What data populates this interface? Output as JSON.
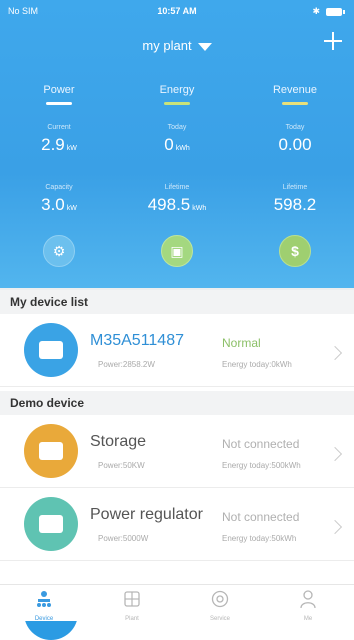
{
  "status_bar": {
    "carrier": "No SIM",
    "time": "10:57 AM"
  },
  "header": {
    "plant_selector": "my plant"
  },
  "tabs": [
    {
      "label": "Power"
    },
    {
      "label": "Energy"
    },
    {
      "label": "Revenue"
    }
  ],
  "stats": {
    "current": {
      "label": "Current",
      "value": "2.9",
      "unit": "kW"
    },
    "today": {
      "label": "Today",
      "value": "0",
      "unit": "kWh"
    },
    "today_revenue": {
      "label": "Today",
      "value": "0.00"
    },
    "capacity": {
      "label": "Capacity",
      "value": "3.0",
      "unit": "kW"
    },
    "lifetime_energy": {
      "label": "Lifetime",
      "value": "498.5",
      "unit": "kWh"
    },
    "lifetime_revenue": {
      "label": "Lifetime",
      "value": "598.2"
    }
  },
  "sections": {
    "my_devices": "My device list",
    "demo": "Demo device"
  },
  "my_devices": [
    {
      "name": "M35A511487",
      "power": "Power:2858.2W",
      "status": "Normal",
      "energy": "Energy today:0kWh"
    }
  ],
  "demo_devices": [
    {
      "name": "Storage",
      "power": "Power:50KW",
      "status": "Not connected",
      "energy": "Energy today:500kWh"
    },
    {
      "name": "Power regulator",
      "power": "Power:5000W",
      "status": "Not connected",
      "energy": "Energy today:50kWh"
    }
  ],
  "tabbar": [
    {
      "label": "Device",
      "icon": "device-icon"
    },
    {
      "label": "Plant",
      "icon": "plant-icon"
    },
    {
      "label": "Service",
      "icon": "service-icon"
    },
    {
      "label": "Me",
      "icon": "user-icon"
    }
  ],
  "colors": {
    "header_blue": "#3fa8ec",
    "accent_link": "#2f8fd6",
    "status_ok": "#8cc068",
    "storage_orange": "#e9a93a",
    "regulator_teal": "#5fc3b2",
    "device_blue": "#3aa3e5"
  }
}
